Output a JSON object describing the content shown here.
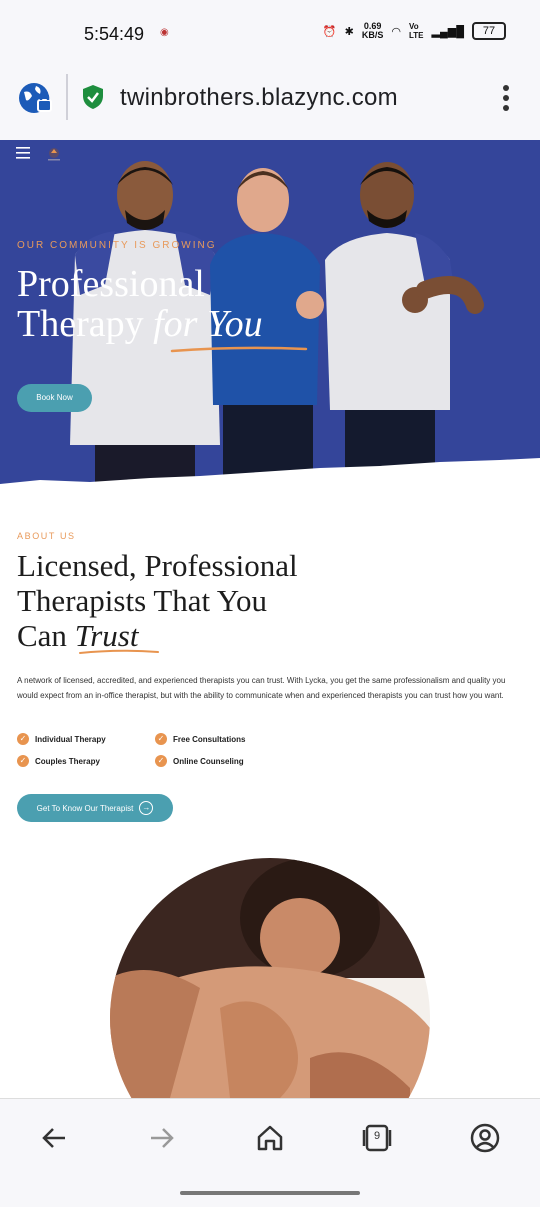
{
  "status": {
    "time": "5:54:49",
    "net_speed_value": "0.69",
    "net_speed_unit": "KB/S",
    "battery": "77"
  },
  "browser": {
    "url": "twinbrothers.blazync.com",
    "tab_count": "9"
  },
  "hero": {
    "eyebrow": "OUR COMMUNITY IS GROWING",
    "title_line1": "Professional",
    "title_line2_plain": "Therapy ",
    "title_line2_italic": "for You",
    "book_button": "Book Now",
    "colors": {
      "background": "#34459a",
      "accent": "#e89a5b",
      "button": "#4b9fb0"
    }
  },
  "about": {
    "eyebrow": "ABOUT US",
    "title_line1": "Licensed, Professional",
    "title_line2": "Therapists That You",
    "title_line3_plain": "Can ",
    "title_line3_italic": "Trust",
    "text": "A network of licensed, accredited, and experienced therapists you can trust. With Lycka, you get the same professionalism and quality you would expect from an in-office therapist, but with the ability to communicate when and experienced therapists you can trust how you want.",
    "features": [
      "Individual Therapy",
      "Free Consultations",
      "Couples Therapy",
      "Online Counseling"
    ],
    "cta": "Get To Know Our Therapist"
  }
}
